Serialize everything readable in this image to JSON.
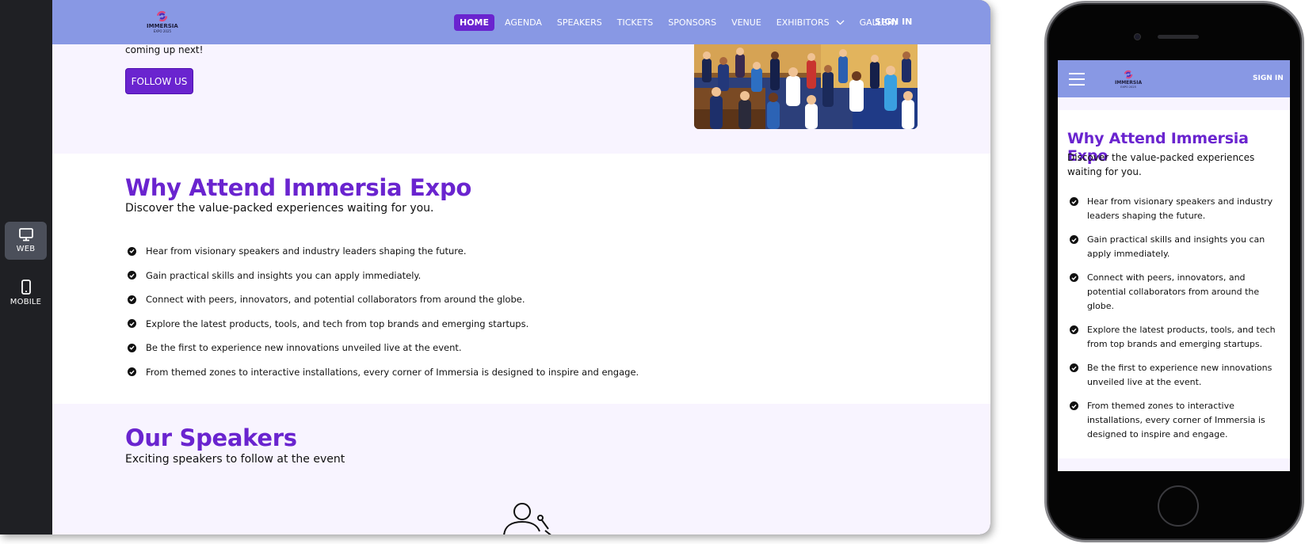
{
  "preview": {
    "web_label": "WEB",
    "mobile_label": "MOBILE"
  },
  "brand": {
    "logo_text": "IMMERSIA",
    "logo_subtext": "EXPO 2025"
  },
  "nav": {
    "items": [
      {
        "label": "HOME",
        "active": true
      },
      {
        "label": "AGENDA"
      },
      {
        "label": "SPEAKERS"
      },
      {
        "label": "TICKETS"
      },
      {
        "label": "SPONSORS"
      },
      {
        "label": "VENUE"
      },
      {
        "label": "EXHIBITORS",
        "has_dropdown": true
      },
      {
        "label": "GALLERY"
      }
    ],
    "sign_in": "SIGN IN"
  },
  "hero": {
    "text_fragment": "coming up next!",
    "follow_button": "FOLLOW US"
  },
  "why": {
    "title": "Why Attend Immersia Expo",
    "subtitle": "Discover the value-packed experiences waiting for you.",
    "items": [
      "Hear from visionary speakers and industry leaders shaping the future.",
      "Gain practical skills and insights you can apply immediately.",
      "Connect with peers, innovators, and potential collaborators from around the globe.",
      "Explore the latest products, tools, and tech from top brands and emerging startups.",
      "Be the first to experience new innovations unveiled live at the event.",
      "From themed zones to interactive installations, every corner of Immersia is designed to inspire and engage."
    ]
  },
  "speakers": {
    "title": "Our Speakers",
    "subtitle": "Exciting speakers to follow at the event"
  },
  "colors": {
    "nav_bg": "#8898e4",
    "accent": "#6a24cf",
    "section_tint": "#f8f4ff",
    "toolbar_bg": "#1f2024"
  }
}
